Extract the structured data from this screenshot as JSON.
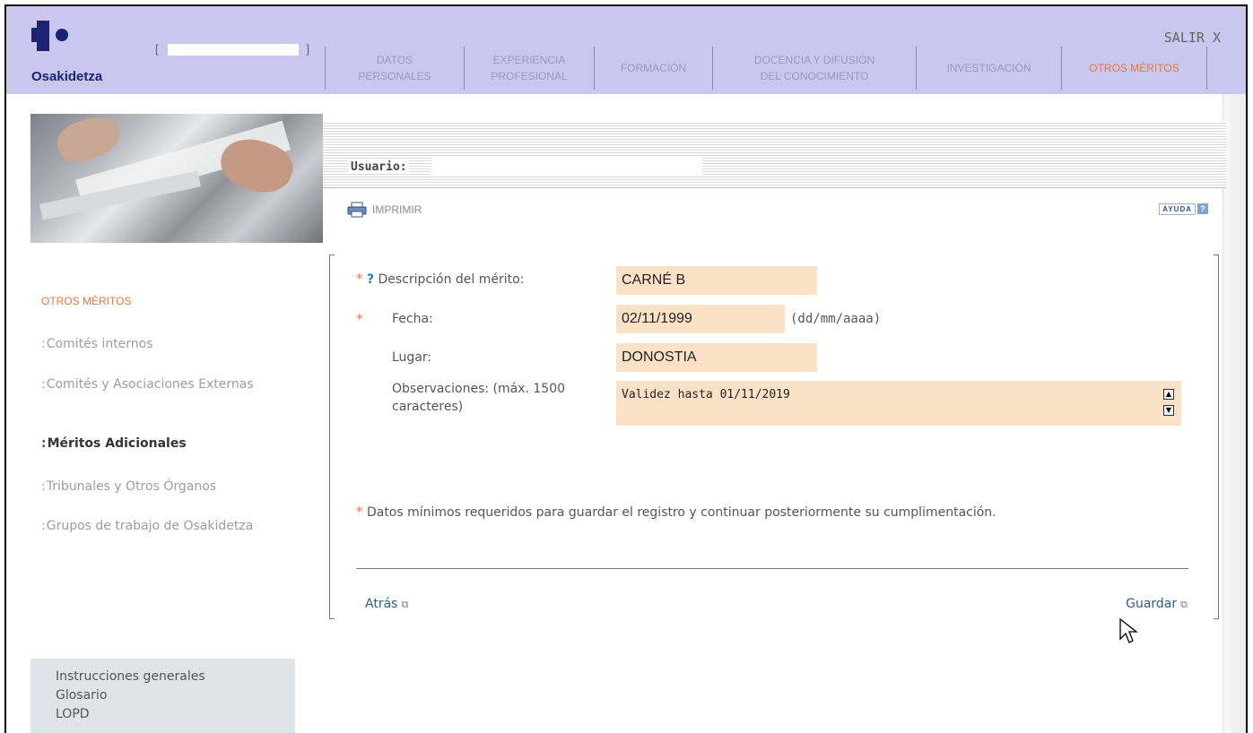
{
  "header": {
    "brand": "Osakidetza",
    "user_bracket_left": "[",
    "user_bracket_right": "]",
    "logout_label": "SALIR",
    "logout_icon": "close-icon",
    "logout_glyph": "X",
    "nav_tabs": [
      {
        "label": "DATOS\nPERSONALES",
        "active": false
      },
      {
        "label": "EXPERIENCIA\nPROFESIONAL",
        "active": false
      },
      {
        "label": "FORMACIÓN",
        "active": false
      },
      {
        "label": "DOCENCIA Y DIFUSIÓN\nDEL CONOCIMIENTO",
        "active": false
      },
      {
        "label": "INVESTIGACIÓN",
        "active": false
      },
      {
        "label": "OTROS MÉRITOS",
        "active": true
      }
    ]
  },
  "toolbar": {
    "usuario_label": "Usuario:",
    "usuario_value": "",
    "print_label": "IMPRIMIR",
    "help_label": "AYUDA",
    "help_glyph": "?"
  },
  "sidebar": {
    "title": "OTROS MÉRITOS",
    "items": [
      {
        "label": "Comités internos",
        "active": false
      },
      {
        "label": "Comités y Asociaciones Externas",
        "active": false
      },
      {
        "label": "Méritos Adicionales",
        "active": true
      },
      {
        "label": "Tribunales y Otros Órganos",
        "active": false
      },
      {
        "label": "Grupos de trabajo de Osakidetza",
        "active": false
      }
    ],
    "footer_links": [
      "Instrucciones generales",
      "Glosario",
      "LOPD"
    ]
  },
  "form": {
    "required_mark": "*",
    "help_mark": "?",
    "descripcion_label": "Descripción del mérito:",
    "descripcion_value": "CARNÉ B",
    "fecha_label": "Fecha:",
    "fecha_value": "02/11/1999",
    "fecha_format": "(dd/mm/aaaa)",
    "lugar_label": "Lugar:",
    "lugar_value": "DONOSTIA",
    "observaciones_label": "Observaciones: (máx. 1500 caracteres)",
    "observaciones_value": "Validez hasta 01/11/2019",
    "required_note": "Datos mínimos requeridos para guardar el registro y continuar posteriormente su cumplimentación.",
    "back_label": "Atrás",
    "save_label": "Guardar"
  },
  "colors": {
    "topbar": "#c9c7ee",
    "accent": "#e8763e",
    "field_bg": "#fbe2c6",
    "link": "#2c5d8a"
  }
}
